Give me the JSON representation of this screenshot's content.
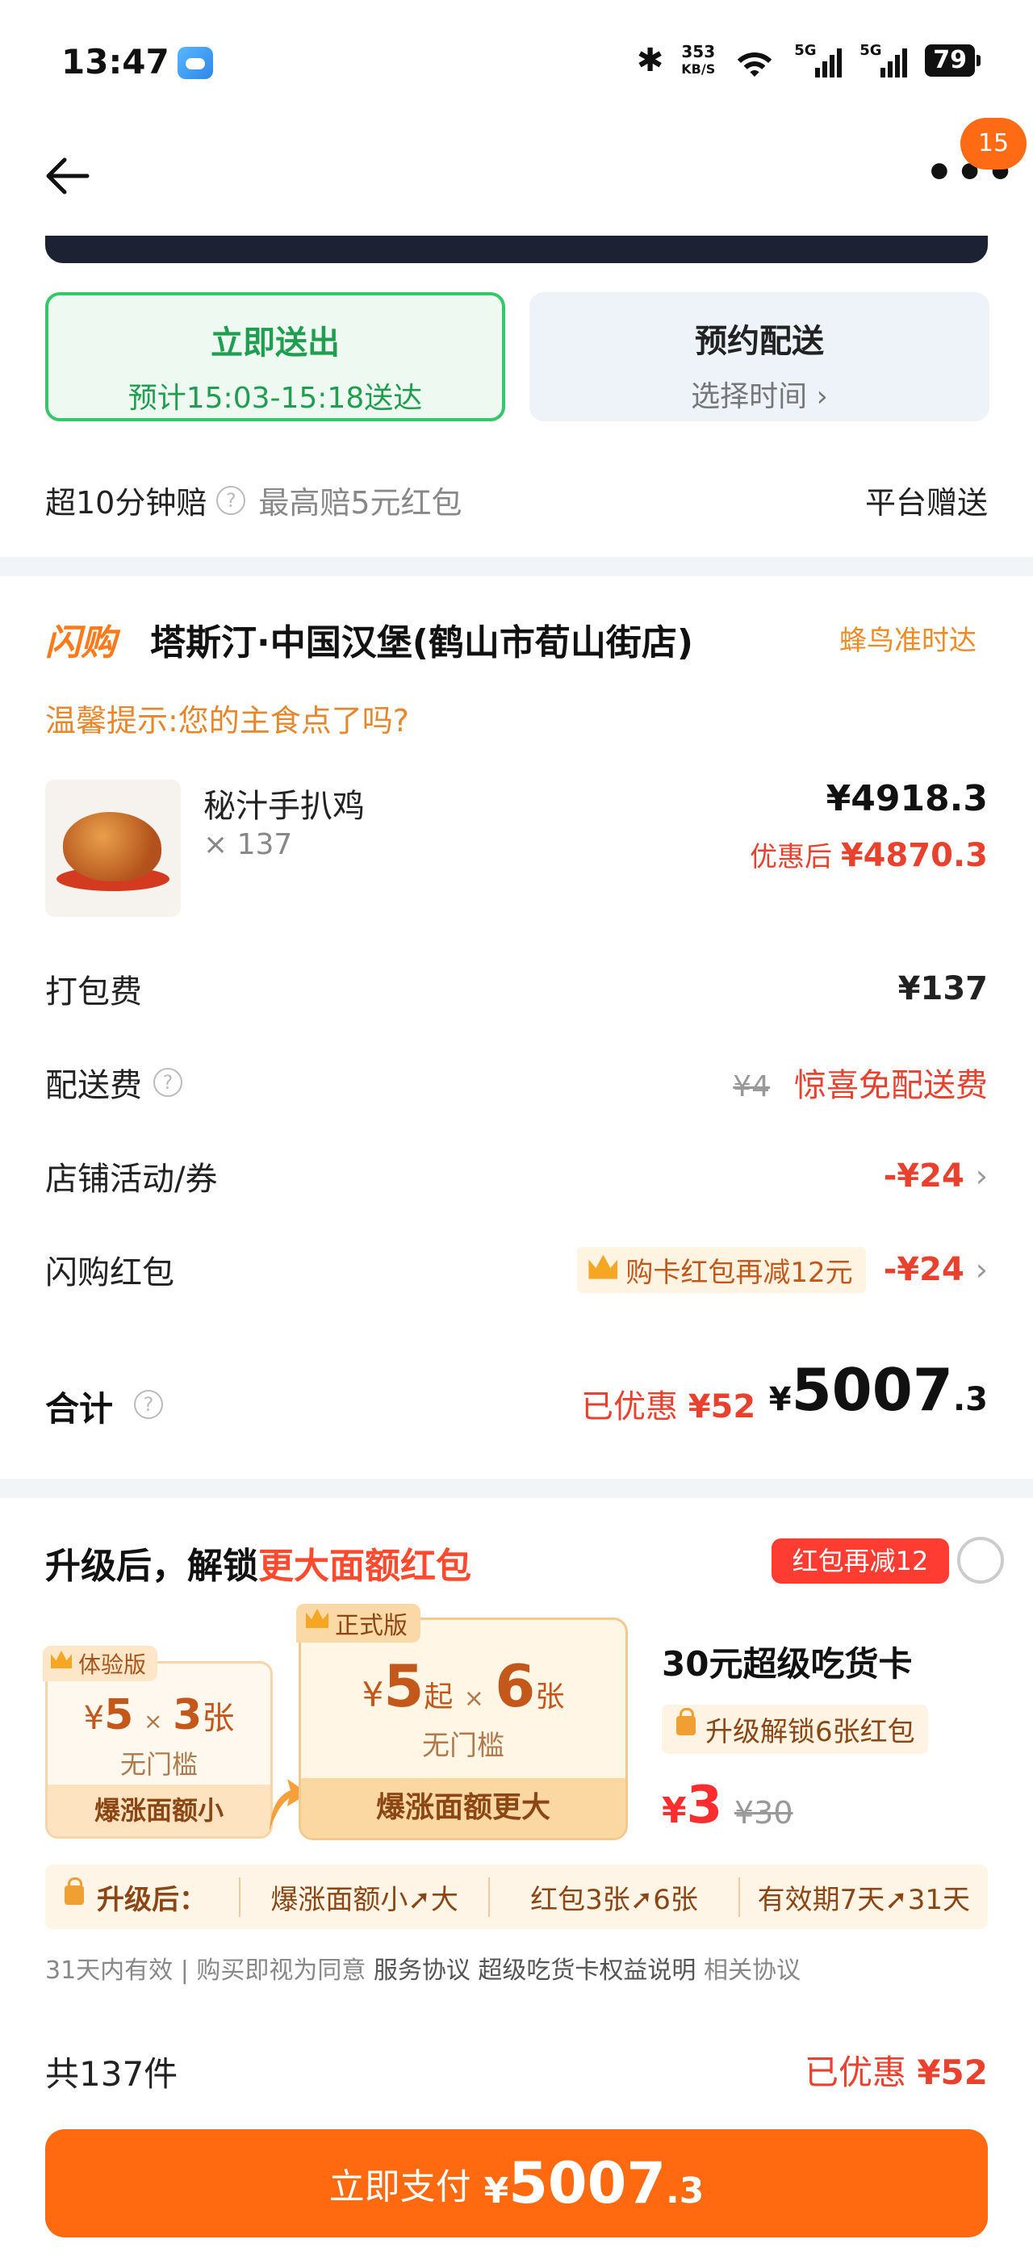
{
  "status": {
    "time": "13:47",
    "net_speed_top": "353",
    "net_speed_unit": "KB/S",
    "signal1": "5G",
    "signal2": "5G",
    "battery": "79"
  },
  "nav": {
    "more": "•••",
    "badge": "15"
  },
  "delivery": {
    "now_title": "立即送出",
    "now_time": "预计15:03-15:18送达",
    "later_title": "预约配送",
    "later_sub": "选择时间 ›"
  },
  "compensation": {
    "label": "超10分钟赔",
    "help": "?",
    "detail": "最高赔5元红包",
    "right": "平台赠送"
  },
  "shop": {
    "logo": "闪购",
    "name": "塔斯汀·中国汉堡(鹤山市荀山街店)",
    "badge": "蜂鸟准时达",
    "tip": "温馨提示:您的主食点了吗?"
  },
  "item": {
    "name": "秘汁手扒鸡",
    "qty": "× 137",
    "price": "¥4918.3",
    "after_label": "优惠后",
    "after_price": "¥4870.3"
  },
  "fees": {
    "packing_label": "打包费",
    "packing_value": "¥137",
    "delivery_label": "配送费",
    "delivery_help": "?",
    "delivery_orig": "¥4",
    "delivery_value": "惊喜免配送费",
    "store_label": "店铺活动/券",
    "store_value": "-¥24",
    "chev": "›",
    "redpack_label": "闪购红包",
    "redpack_tag": "购卡红包再减12元",
    "redpack_value": "-¥24"
  },
  "total": {
    "label": "合计",
    "help": "?",
    "disc_label": "已优惠",
    "disc_value": "¥52",
    "currency": "¥",
    "int": "5007",
    "dec": ".3"
  },
  "upgrade": {
    "title_prefix": "升级后，解锁",
    "title_hl": "更大面额红包",
    "tag": "红包再减12",
    "trial": {
      "label": "体验版",
      "cur": "¥",
      "amt": "5",
      "x": "×",
      "count": "3",
      "unit": "张",
      "sub": "无门槛",
      "foot": "爆涨面额小"
    },
    "formal": {
      "label": "正式版",
      "cur": "¥",
      "amt": "5",
      "start": "起",
      "x": "×",
      "count": "6",
      "unit": "张",
      "sub": "无门槛",
      "foot": "爆涨面额更大"
    },
    "card_name": "30元超级吃货卡",
    "unlock": "升级解锁6张红包",
    "price_cur": "¥",
    "price": "3",
    "price_was": "¥30",
    "benefits_lead": "升级后：",
    "benefits": [
      "爆涨面额小➚大",
      "红包3张➚6张",
      "有效期7天➚31天"
    ],
    "terms_a": "31天内有效 | 购买即视为同意 ",
    "terms_b": "服务协议 超级吃货卡权益说明",
    "terms_c": " 相关协议"
  },
  "footer": {
    "count": "共137件",
    "saved_label": "已优惠 ",
    "saved_value": "¥52",
    "pay_label": "立即支付",
    "pay_cur": "¥",
    "pay_int": "5007",
    "pay_dec": ".3"
  },
  "colors": {
    "accent": "#ff6a10",
    "green": "#36c76b",
    "red": "#e8422f",
    "dark_bar": "#1c2233"
  }
}
